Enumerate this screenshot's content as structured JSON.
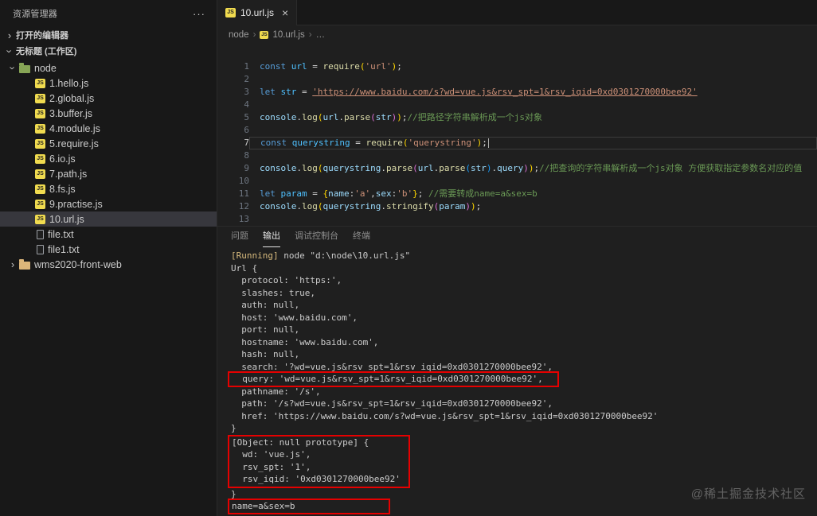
{
  "colors": {
    "annotation_red": "#e60000",
    "js_icon_yellow": "#f0db4f",
    "keyword": "#569cd6",
    "variable": "#9cdcfe",
    "const_variable": "#4fc1ff",
    "function": "#dcdcaa",
    "string": "#ce9178",
    "comment": "#6a9955",
    "folder_node": "#87a556",
    "folder_default": "#dcb67a",
    "selected_row": "#37373d"
  },
  "icons": {
    "chevron": "›",
    "close": "×",
    "more": "···",
    "separator": "›",
    "ellipsis": "…",
    "js_badge": "JS"
  },
  "sidebar": {
    "title": "资源管理器",
    "open_editors": "打开的编辑器",
    "workspace": "无标题 (工作区)",
    "tree": [
      {
        "label": "node",
        "icon": "folder",
        "folderColor": "folder_node",
        "twisty": "open",
        "depth": 1
      },
      {
        "label": "1.hello.js",
        "icon": "js",
        "depth": 2
      },
      {
        "label": "2.global.js",
        "icon": "js",
        "depth": 2
      },
      {
        "label": "3.buffer.js",
        "icon": "js",
        "depth": 2
      },
      {
        "label": "4.module.js",
        "icon": "js",
        "depth": 2
      },
      {
        "label": "5.require.js",
        "icon": "js",
        "depth": 2
      },
      {
        "label": "6.io.js",
        "icon": "js",
        "depth": 2
      },
      {
        "label": "7.path.js",
        "icon": "js",
        "depth": 2
      },
      {
        "label": "8.fs.js",
        "icon": "js",
        "depth": 2
      },
      {
        "label": "9.practise.js",
        "icon": "js",
        "depth": 2
      },
      {
        "label": "10.url.js",
        "icon": "js",
        "depth": 2,
        "selected": true
      },
      {
        "label": "file.txt",
        "icon": "txt",
        "depth": 2
      },
      {
        "label": "file1.txt",
        "icon": "txt",
        "depth": 2
      },
      {
        "label": "wms2020-front-web",
        "icon": "folder",
        "folderColor": "folder_default",
        "twisty": "closed",
        "depth": 1
      }
    ]
  },
  "editor": {
    "tab": {
      "title": "10.url.js"
    },
    "breadcrumb": [
      {
        "label": "node"
      },
      {
        "label": "10.url.js",
        "icon": "js"
      },
      {
        "label": "…"
      }
    ],
    "lines": [
      {
        "n": 1,
        "tokens": [
          [
            "kw",
            "const "
          ],
          [
            "cv",
            "url "
          ],
          [
            "op",
            "= "
          ],
          [
            "fn",
            "require"
          ],
          [
            "b1",
            "("
          ],
          [
            "str",
            "'url'"
          ],
          [
            "b1",
            ")"
          ],
          [
            "pn",
            ";"
          ]
        ]
      },
      {
        "n": 2,
        "tokens": []
      },
      {
        "n": 3,
        "tokens": [
          [
            "kw",
            "let "
          ],
          [
            "cv",
            "str "
          ],
          [
            "op",
            "= "
          ],
          [
            "stru",
            "'https://www.baidu.com/s?wd=vue.js&rsv_spt=1&rsv_iqid=0xd0301270000bee92'"
          ]
        ]
      },
      {
        "n": 4,
        "tokens": []
      },
      {
        "n": 5,
        "tokens": [
          [
            "v",
            "console"
          ],
          [
            "pn",
            "."
          ],
          [
            "fn",
            "log"
          ],
          [
            "b1",
            "("
          ],
          [
            "v",
            "url"
          ],
          [
            "pn",
            "."
          ],
          [
            "fn",
            "parse"
          ],
          [
            "b2",
            "("
          ],
          [
            "v",
            "str"
          ],
          [
            "b2",
            ")"
          ],
          [
            "b1",
            ")"
          ],
          [
            "pn",
            ";"
          ],
          [
            "cm",
            "//把路径字符串解析成一个js对象"
          ]
        ]
      },
      {
        "n": 6,
        "tokens": []
      },
      {
        "n": 7,
        "current": true,
        "cursor": true,
        "tokens": [
          [
            "kw",
            "const "
          ],
          [
            "cv",
            "querystring "
          ],
          [
            "op",
            "= "
          ],
          [
            "fn",
            "require"
          ],
          [
            "b1",
            "("
          ],
          [
            "str",
            "'querystring'"
          ],
          [
            "b1",
            ")"
          ],
          [
            "pn",
            ";"
          ]
        ]
      },
      {
        "n": 8,
        "tokens": []
      },
      {
        "n": 9,
        "tokens": [
          [
            "v",
            "console"
          ],
          [
            "pn",
            "."
          ],
          [
            "fn",
            "log"
          ],
          [
            "b1",
            "("
          ],
          [
            "v",
            "querystring"
          ],
          [
            "pn",
            "."
          ],
          [
            "fn",
            "parse"
          ],
          [
            "b2",
            "("
          ],
          [
            "v",
            "url"
          ],
          [
            "pn",
            "."
          ],
          [
            "fn",
            "parse"
          ],
          [
            "b3",
            "("
          ],
          [
            "v",
            "str"
          ],
          [
            "b3",
            ")"
          ],
          [
            "pn",
            "."
          ],
          [
            "v",
            "query"
          ],
          [
            "b2",
            ")"
          ],
          [
            "b1",
            ")"
          ],
          [
            "pn",
            ";"
          ],
          [
            "cm",
            "//把查询的字符串解析成一个js对象 方便获取指定参数名对应的值"
          ]
        ]
      },
      {
        "n": 10,
        "tokens": []
      },
      {
        "n": 11,
        "tokens": [
          [
            "kw",
            "let "
          ],
          [
            "cv",
            "param "
          ],
          [
            "op",
            "= "
          ],
          [
            "b1",
            "{"
          ],
          [
            "v",
            "name"
          ],
          [
            "pn",
            ":"
          ],
          [
            "str",
            "'a'"
          ],
          [
            "pn",
            ","
          ],
          [
            "v",
            "sex"
          ],
          [
            "pn",
            ":"
          ],
          [
            "str",
            "'b'"
          ],
          [
            "b1",
            "}"
          ],
          [
            "pn",
            "; "
          ],
          [
            "cm",
            "//需要转成name=a&sex=b"
          ]
        ]
      },
      {
        "n": 12,
        "tokens": [
          [
            "v",
            "console"
          ],
          [
            "pn",
            "."
          ],
          [
            "fn",
            "log"
          ],
          [
            "b1",
            "("
          ],
          [
            "v",
            "querystring"
          ],
          [
            "pn",
            "."
          ],
          [
            "fn",
            "stringify"
          ],
          [
            "b2",
            "("
          ],
          [
            "v",
            "param"
          ],
          [
            "b2",
            ")"
          ],
          [
            "b1",
            ")"
          ],
          [
            "pn",
            ";"
          ]
        ]
      },
      {
        "n": 13,
        "tokens": []
      }
    ]
  },
  "panel": {
    "tabs": [
      {
        "label": "问题"
      },
      {
        "label": "输出",
        "active": true
      },
      {
        "label": "调试控制台"
      },
      {
        "label": "终端"
      }
    ],
    "output": [
      {
        "type": "run",
        "prefix": "[Running] ",
        "rest": "node \"d:\\node\\10.url.js\""
      },
      {
        "type": "line",
        "text": "Url {"
      },
      {
        "type": "line",
        "text": "  protocol: 'https:',"
      },
      {
        "type": "line",
        "text": "  slashes: true,"
      },
      {
        "type": "line",
        "text": "  auth: null,"
      },
      {
        "type": "line",
        "text": "  host: 'www.baidu.com',"
      },
      {
        "type": "line",
        "text": "  port: null,"
      },
      {
        "type": "line",
        "text": "  hostname: 'www.baidu.com',"
      },
      {
        "type": "line",
        "text": "  hash: null,"
      },
      {
        "type": "line",
        "text": "  search: '?wd=vue.js&rsv_spt=1&rsv_iqid=0xd0301270000bee92',"
      },
      {
        "type": "boxline",
        "text": "  query: 'wd=vue.js&rsv_spt=1&rsv_iqid=0xd0301270000bee92',"
      },
      {
        "type": "line",
        "text": "  pathname: '/s',"
      },
      {
        "type": "line",
        "text": "  path: '/s?wd=vue.js&rsv_spt=1&rsv_iqid=0xd0301270000bee92',"
      },
      {
        "type": "line",
        "text": "  href: 'https://www.baidu.com/s?wd=vue.js&rsv_spt=1&rsv_iqid=0xd0301270000bee92'"
      },
      {
        "type": "line",
        "text": "}"
      },
      {
        "type": "boxblock",
        "lines": [
          "[Object: null prototype] {",
          "  wd: 'vue.js',",
          "  rsv_spt: '1',",
          "  rsv_iqid: '0xd0301270000bee92'"
        ]
      },
      {
        "type": "line",
        "text": "}"
      },
      {
        "type": "boxline",
        "wide": true,
        "text": "name=a&sex=b"
      }
    ]
  },
  "watermark": "@稀土掘金技术社区"
}
